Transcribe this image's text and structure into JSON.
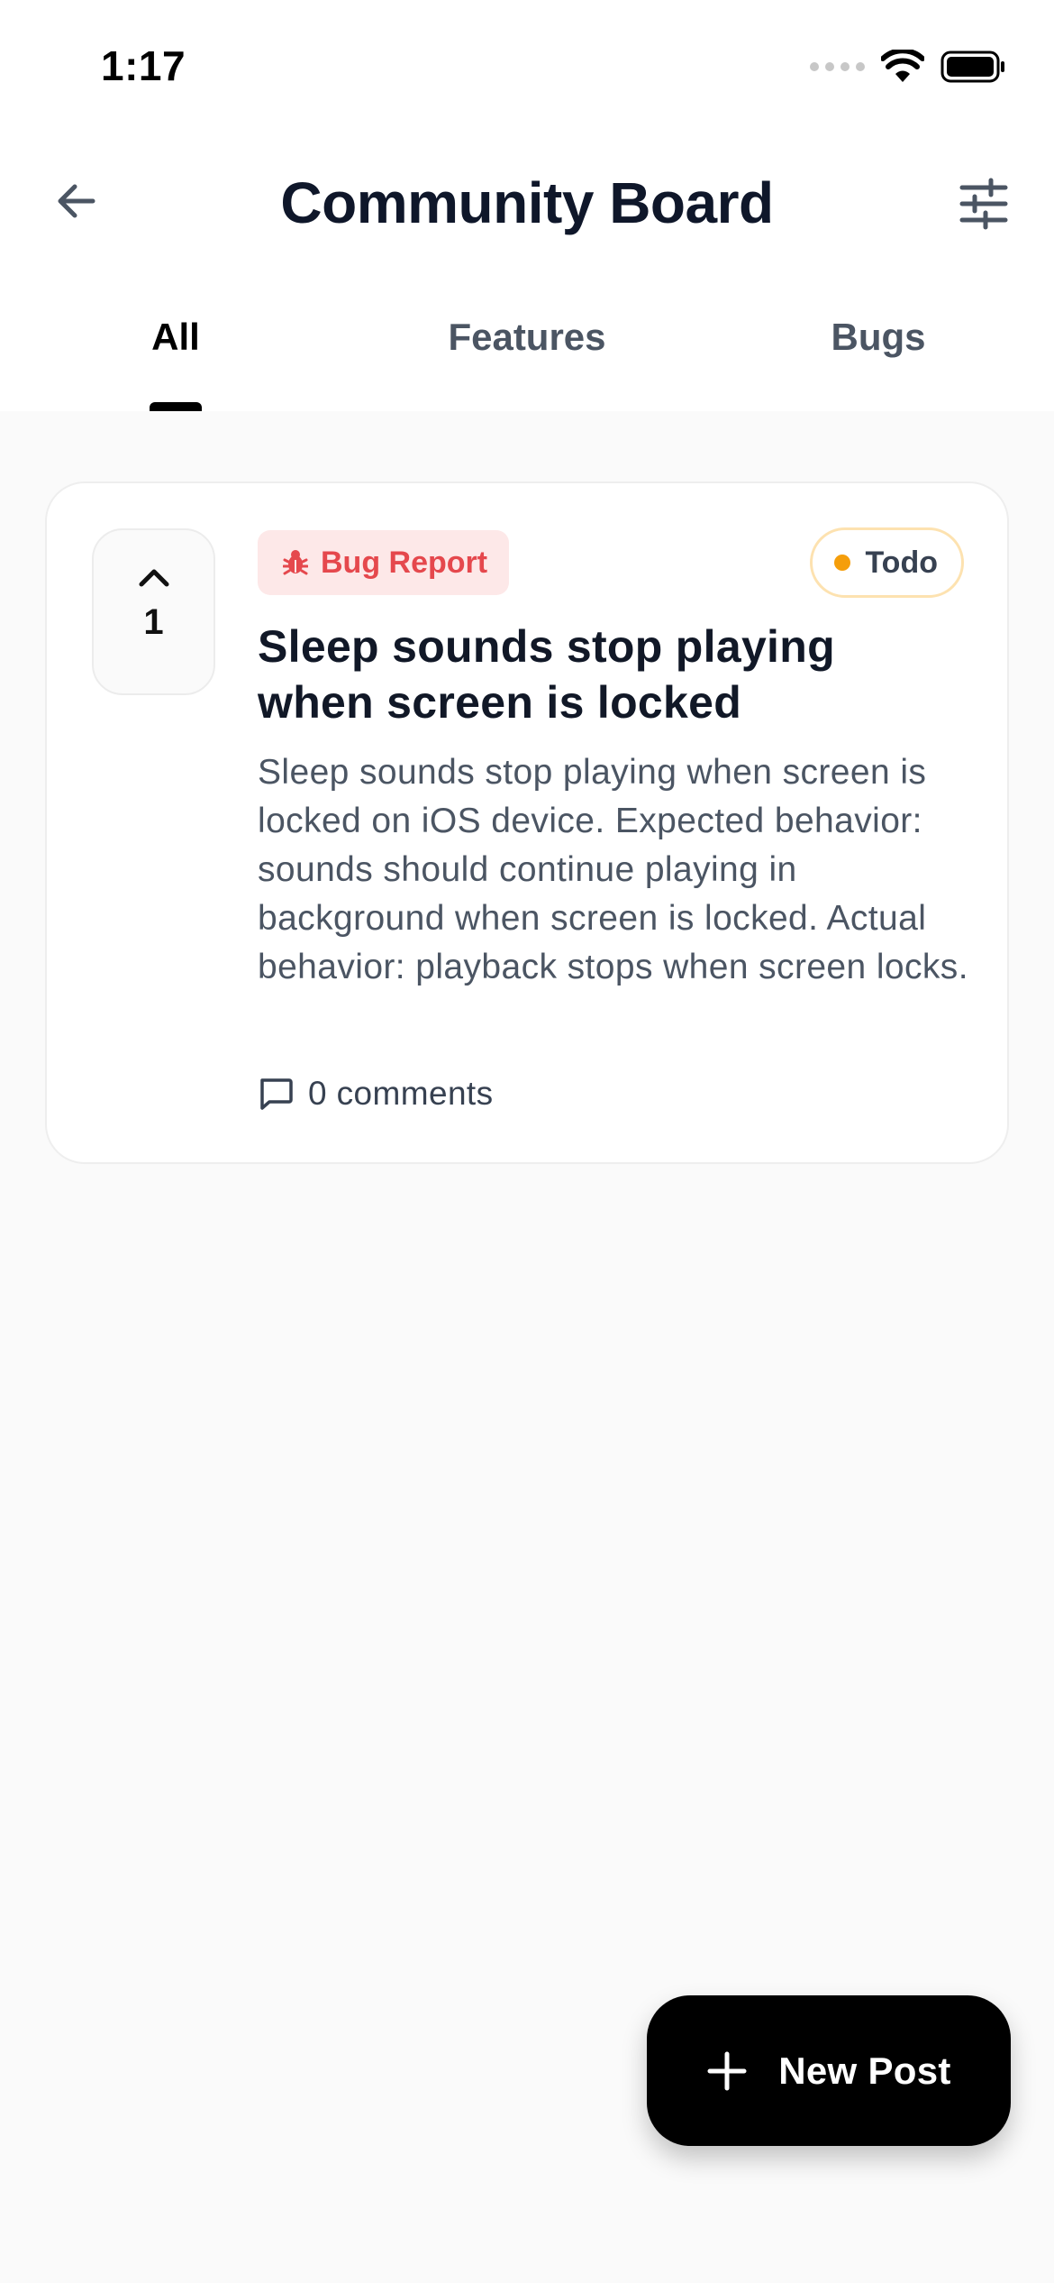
{
  "status_bar": {
    "time": "1:17"
  },
  "header": {
    "title": "Community Board"
  },
  "tabs": [
    {
      "label": "All",
      "active": true
    },
    {
      "label": "Features",
      "active": false
    },
    {
      "label": "Bugs",
      "active": false
    }
  ],
  "posts": [
    {
      "votes": "1",
      "category": "Bug Report",
      "status": "Todo",
      "title": "Sleep sounds stop playing when screen is locked",
      "body": "Sleep sounds stop playing when screen is locked on iOS device. Expected behavior: sounds should continue playing in background when screen is locked. Actual behavior: playback stops when screen locks.",
      "comments": "0 comments"
    }
  ],
  "fab": {
    "label": "New Post"
  },
  "icons": {
    "back": "arrow-left-icon",
    "filter": "sliders-icon",
    "upvote": "chevron-up-icon",
    "bug": "bug-icon",
    "comment": "comment-icon",
    "plus": "plus-icon"
  },
  "colors": {
    "accent": "#000000",
    "bug_badge_bg": "#fde8e8",
    "bug_badge_text": "#e5484d",
    "status_dot": "#f59e0b",
    "status_border": "#fde2b0"
  }
}
